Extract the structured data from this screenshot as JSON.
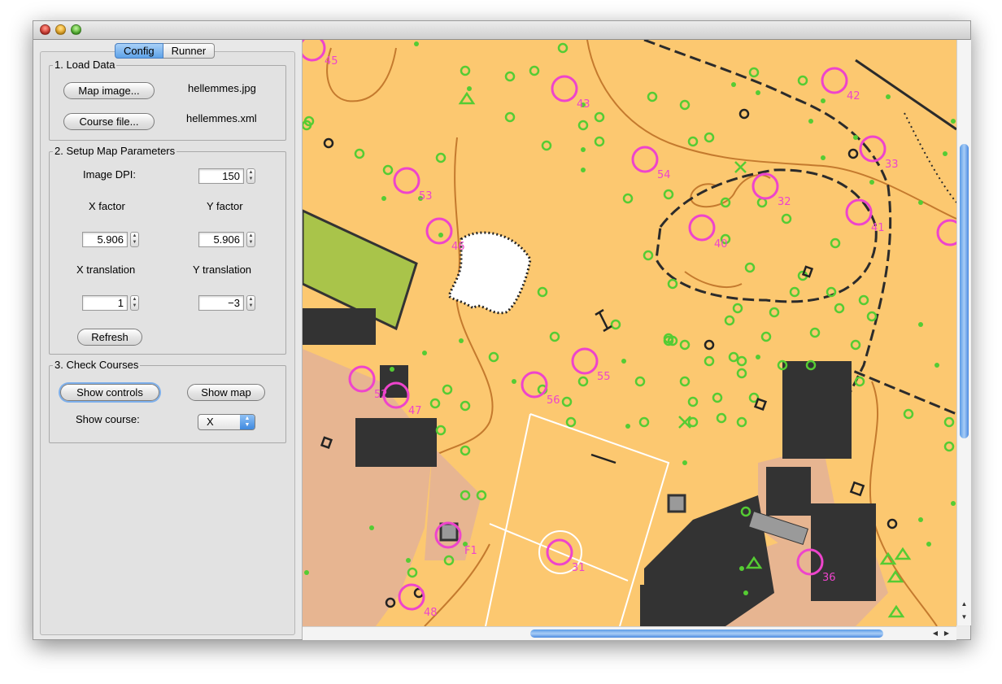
{
  "window": {
    "tabs": [
      {
        "label": "Config",
        "active": true
      },
      {
        "label": "Runner",
        "active": false
      }
    ]
  },
  "load_data": {
    "title": "1. Load Data",
    "map_button": "Map image...",
    "map_file": "hellemmes.jpg",
    "course_button": "Course file...",
    "course_file": "hellemmes.xml"
  },
  "map_params": {
    "title": "2. Setup Map Parameters",
    "dpi_label": "Image DPI:",
    "dpi_value": "150",
    "x_factor_label": "X factor",
    "y_factor_label": "Y factor",
    "x_factor_value": "5.906",
    "y_factor_value": "5.906",
    "x_translation_label": "X translation",
    "y_translation_label": "Y translation",
    "x_translation_value": "1",
    "y_translation_value": "−3",
    "refresh_button": "Refresh"
  },
  "check_courses": {
    "title": "3. Check Courses",
    "show_controls_button": "Show controls",
    "show_map_button": "Show map",
    "show_course_label": "Show course:",
    "course_selected": "X"
  },
  "map": {
    "controls": [
      {
        "label": "45"
      },
      {
        "label": "43"
      },
      {
        "label": "42"
      },
      {
        "label": "33"
      },
      {
        "label": "53"
      },
      {
        "label": "54"
      },
      {
        "label": "32"
      },
      {
        "label": "41"
      },
      {
        "label": "46"
      },
      {
        "label": "40"
      },
      {
        "label": "55"
      },
      {
        "label": "56"
      },
      {
        "label": "52"
      },
      {
        "label": "47"
      },
      {
        "label": "F1"
      },
      {
        "label": "31"
      },
      {
        "label": "36"
      },
      {
        "label": "48"
      }
    ],
    "colors": {
      "open_land": "#fcc870",
      "building": "#333333",
      "paved": "#e7b591",
      "vegetation": "#a9c44a",
      "control": "#ee44cc",
      "tree": "#55cc33"
    }
  },
  "scroll": {
    "vertical_position": 0.2,
    "horizontal_position": 0.45
  }
}
